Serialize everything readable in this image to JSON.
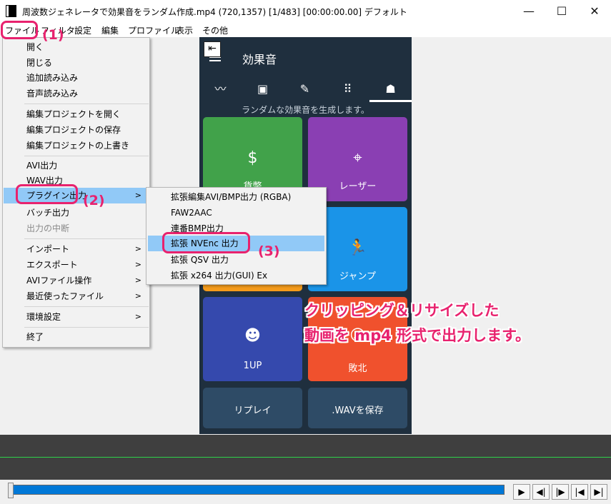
{
  "window": {
    "title": "周波数ジェネレータで効果音をランダム作成.mp4 (720,1357)  [1/483]  [00:00:00.00]  デフォルト",
    "minimize": "—",
    "maximize": "☐",
    "close": "✕"
  },
  "menubar": {
    "items": [
      "ファイル",
      "フィルタ",
      "設定",
      "編集",
      "プロファイル",
      "表示",
      "その他"
    ]
  },
  "file_menu": {
    "items": [
      {
        "label": "開く"
      },
      {
        "label": "閉じる"
      },
      {
        "label": "追加読み込み"
      },
      {
        "label": "音声読み込み"
      },
      {
        "label": "編集プロジェクトを開く"
      },
      {
        "label": "編集プロジェクトの保存"
      },
      {
        "label": "編集プロジェクトの上書き"
      },
      {
        "label": "AVI出力"
      },
      {
        "label": "WAV出力"
      },
      {
        "label": "プラグイン出力"
      },
      {
        "label": "バッチ出力"
      },
      {
        "label": "出力の中断"
      },
      {
        "label": "インポート"
      },
      {
        "label": "エクスポート"
      },
      {
        "label": "AVIファイル操作"
      },
      {
        "label": "最近使ったファイル"
      },
      {
        "label": "環境設定"
      },
      {
        "label": "終了"
      }
    ],
    "submenu_arrow": ">"
  },
  "plugin_menu": {
    "items": [
      "拡張編集AVI/BMP出力 (RGBA)",
      "FAW2AAC",
      "連番BMP出力",
      "拡張 NVEnc 出力",
      "拡張 QSV 出力",
      "拡張 x264 出力(GUI) Ex"
    ]
  },
  "preview": {
    "title": "効果音",
    "subtitle": "ランダムな効果音を生成します。",
    "tabs": [
      "〰",
      "▣",
      "✎",
      "⠿",
      "☗"
    ],
    "tiles": {
      "coin": "貨幣",
      "laser": "レーザー",
      "jump": "ジャンプ",
      "oneup": "1UP",
      "defeat": "敗北",
      "replay": "リプレイ",
      "save_wav": ".WAVを保存"
    },
    "icons": {
      "back": "⇤",
      "coin": "$",
      "laser": "⌖",
      "jump": "🏃",
      "oneup": "☻",
      "defeat": "☹"
    }
  },
  "annotations": {
    "step1": "(1)",
    "step2": "(2)",
    "step3": "(3)",
    "note_line1": "クリッピング＆リサイズした",
    "note_line2": "動画を mp4 形式で出力します。"
  },
  "player": {
    "buttons": [
      "▶",
      "◀|",
      "|▶",
      "|◀",
      "▶|"
    ]
  },
  "colors": {
    "accent_pink": "#e8226e",
    "highlight": "#91c9f7",
    "preview_bg": "#1f2f3e",
    "coin_tile": "#41a24a",
    "laser_tile": "#8a3fb3",
    "jump_tile": "#1a94e8",
    "oneup_tile": "#3549ad",
    "defeat_tile": "#f0512d",
    "button_tile": "#2e4b66",
    "seek_blue": "#0078d7"
  }
}
